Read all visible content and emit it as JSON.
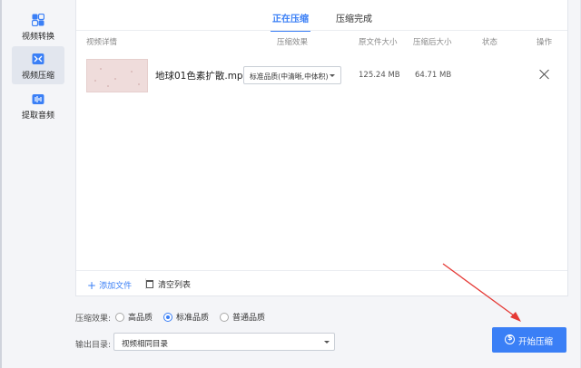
{
  "sidebar": {
    "items": [
      {
        "label": "视频转换",
        "icon": "convert-icon"
      },
      {
        "label": "视频压缩",
        "icon": "compress-icon"
      },
      {
        "label": "提取音频",
        "icon": "audio-extract-icon"
      }
    ]
  },
  "tabs": {
    "active": "正在压缩",
    "inactive": "压缩完成"
  },
  "table": {
    "headers": [
      "视频详情",
      "压缩效果",
      "原文件大小",
      "压缩后大小",
      "状态",
      "操作"
    ],
    "rows": [
      {
        "file_name": "地球01色素扩散.mp4",
        "quality": "标准品质(中清晰,中体积)",
        "original_size": "125.24 MB",
        "compressed_size": "64.71 MB",
        "status": ""
      }
    ]
  },
  "footer": {
    "add_file": "添加文件",
    "clear_list": "清空列表"
  },
  "options": {
    "effect_label": "压缩效果:",
    "choices": [
      "高品质",
      "标准品质",
      "普通品质"
    ],
    "selected": "标准品质",
    "output_label": "输出目录:",
    "output_value": "视频相同目录"
  },
  "start_button": "开始压缩",
  "colors": {
    "accent": "#3a7ff6",
    "arrow": "#e53935"
  }
}
